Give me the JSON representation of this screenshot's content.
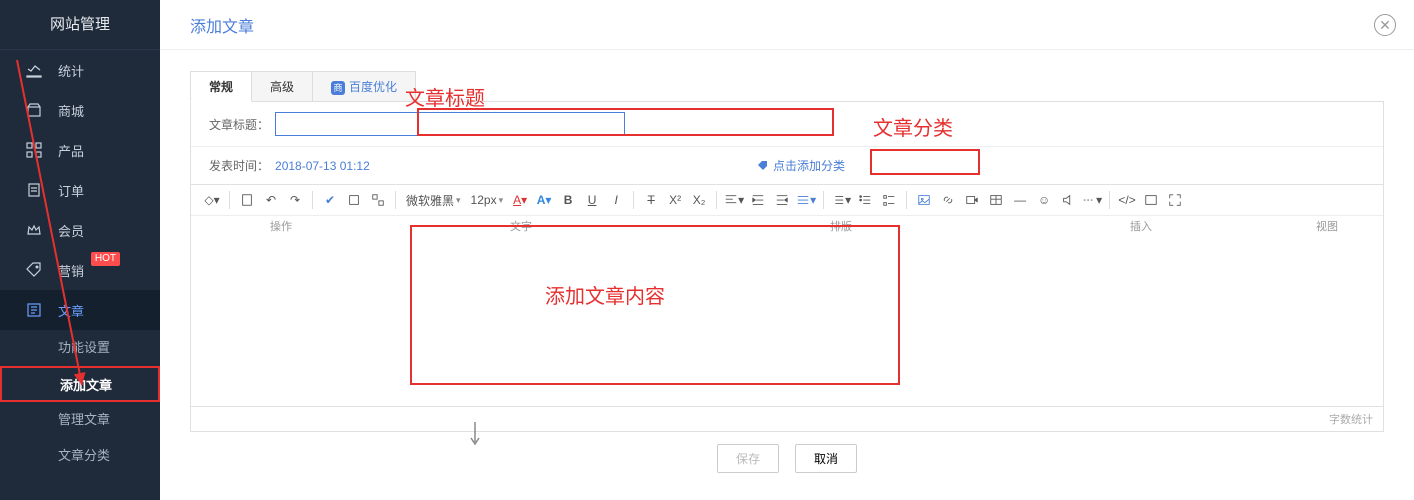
{
  "sidebar": {
    "title": "网站管理",
    "items": [
      {
        "label": "统计"
      },
      {
        "label": "商城"
      },
      {
        "label": "产品"
      },
      {
        "label": "订单"
      },
      {
        "label": "会员"
      },
      {
        "label": "营销",
        "badge": "HOT"
      },
      {
        "label": "文章"
      }
    ],
    "subitems": [
      {
        "label": "功能设置"
      },
      {
        "label": "添加文章"
      },
      {
        "label": "管理文章"
      },
      {
        "label": "文章分类"
      }
    ]
  },
  "page": {
    "title": "添加文章"
  },
  "tabs": [
    {
      "label": "常规"
    },
    {
      "label": "高级"
    },
    {
      "label": "百度优化"
    }
  ],
  "form": {
    "title_label": "文章标题：",
    "title_value": "",
    "date_label": "发表时间：",
    "date_value": "2018-07-13 01:12",
    "category_link": "点击添加分类"
  },
  "toolbar": {
    "font_family": "微软雅黑",
    "font_size": "12px",
    "group_labels": [
      "操作",
      "文字",
      "排版",
      "插入",
      "视图"
    ]
  },
  "editor": {
    "wordcount_label": "字数统计"
  },
  "footer": {
    "save": "保存",
    "cancel": "取消"
  },
  "annotations": {
    "title_hint": "文章标题",
    "category_hint": "文章分类",
    "content_hint": "添加文章内容"
  }
}
